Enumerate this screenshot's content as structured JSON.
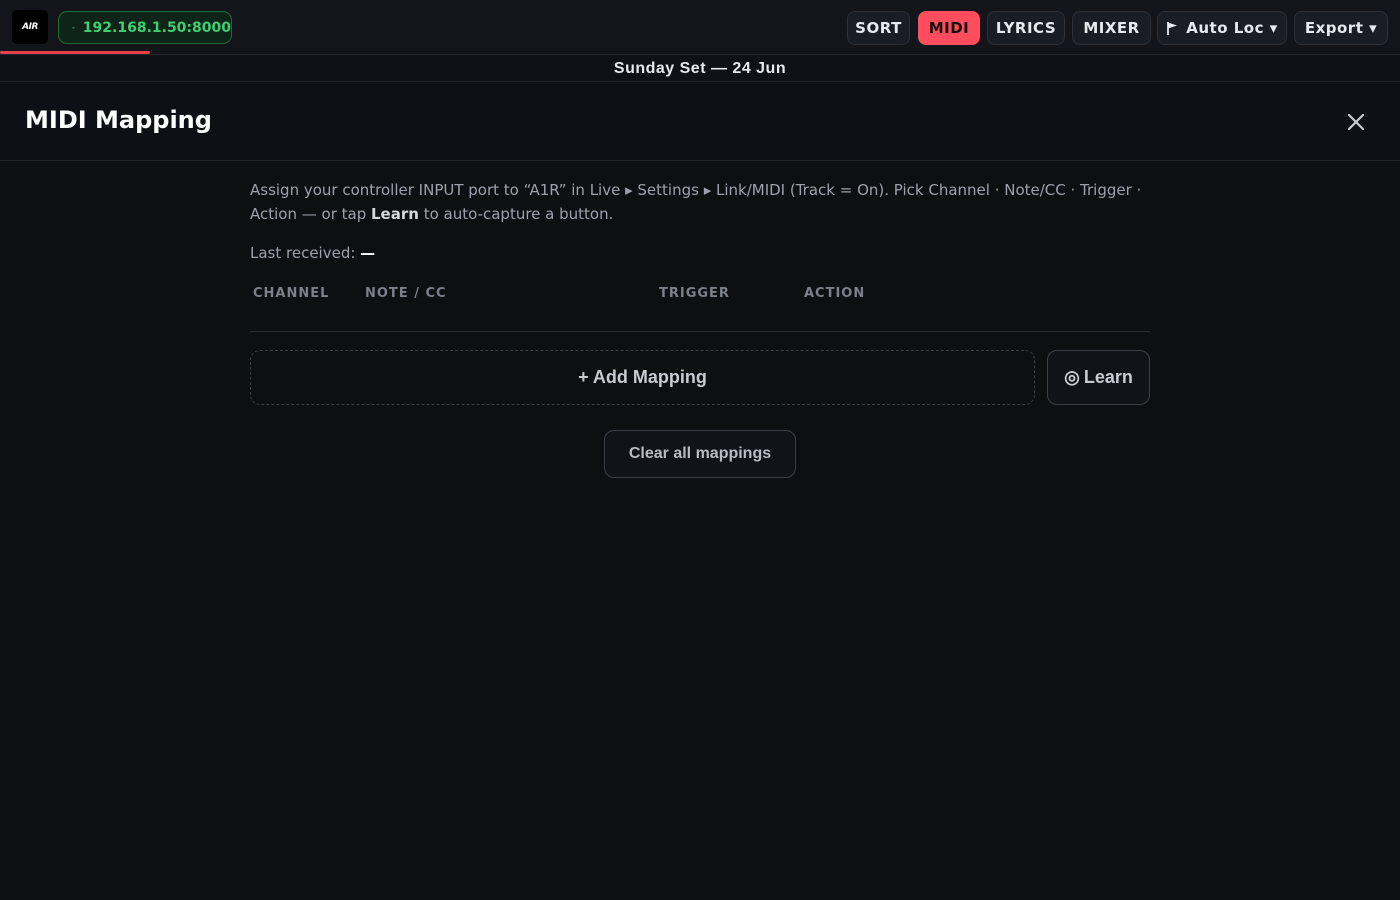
{
  "app": {
    "logo_text": "AIR",
    "connection": "192.168.1.50:8000"
  },
  "toolbar": {
    "sort": "SORT",
    "midi": "MIDI",
    "lyrics": "LYRICS",
    "mixer": "MIXER",
    "auto_loc": "Auto Loc ▾",
    "export": "Export ▾"
  },
  "set_title": "Sunday Set — 24 Jun",
  "panel": {
    "title": "MIDI Mapping",
    "description_part1": "Assign your controller INPUT port to “A1R” in Live ▸ Settings ▸ Link/MIDI (Track = On). Pick Channel · Note/CC · Trigger · Action — or tap ",
    "description_bold": "Learn",
    "description_part2": " to auto-capture a button.",
    "last_received_label": "Last received: ",
    "last_received_value": "—",
    "columns": [
      "CHANNEL",
      "NOTE / CC",
      "TRIGGER",
      "ACTION"
    ],
    "add_mapping": "+ Add Mapping",
    "learn_icon": "◎",
    "learn": "Learn",
    "clear_all": "Clear all mappings"
  },
  "colors": {
    "accent": "#ff4d5e",
    "connected": "#3ecf72",
    "background": "#0e0f13"
  }
}
